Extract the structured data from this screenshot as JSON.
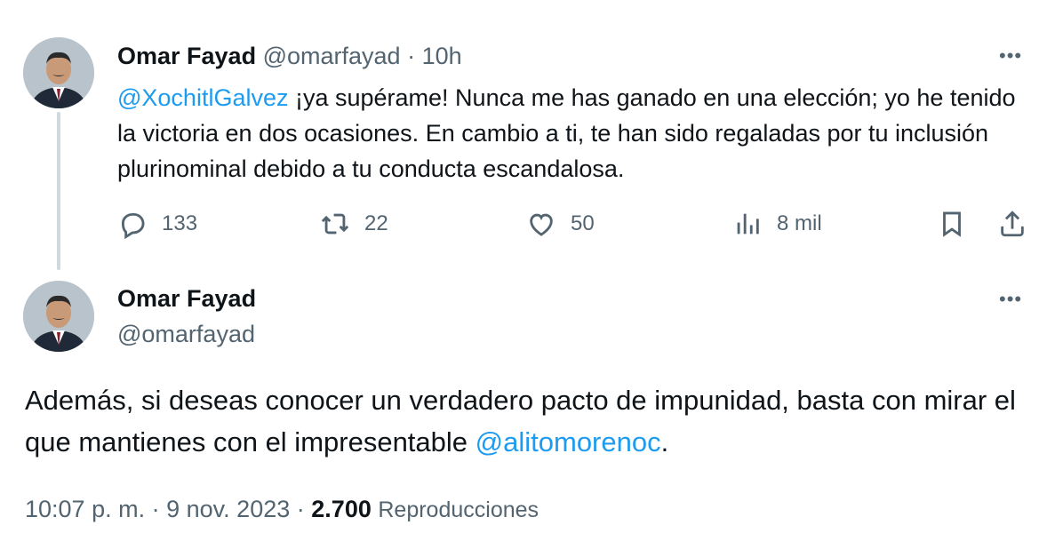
{
  "tweet1": {
    "author_name": "Omar Fayad",
    "author_handle": "@omarfayad",
    "separator": "·",
    "time_ago": "10h",
    "mention": "@XochitlGalvez",
    "text": " ¡ya supérame! Nunca me has ganado en una elección; yo he tenido la victoria en dos ocasiones. En cambio a ti, te han sido regaladas por tu inclusión plurinominal debido a tu conducta escandalosa.",
    "more_icon": "more-horizontal-icon",
    "actions": {
      "replies": "133",
      "retweets": "22",
      "likes": "50",
      "views": "8 mil"
    }
  },
  "tweet2": {
    "author_name": "Omar Fayad",
    "author_handle": "@omarfayad",
    "more_icon": "more-horizontal-icon",
    "text_before": "Además, si deseas conocer un verdadero pacto de impunidad, basta con mirar el que mantienes con el impresentable ",
    "mention": "@alitomorenoc",
    "text_after": ".",
    "time": "10:07 p. m.",
    "sep1": "·",
    "date": "9 nov. 2023",
    "sep2": "·",
    "views_count": "2.700",
    "views_label": "Reproducciones"
  },
  "colors": {
    "accent": "#1d9bf0",
    "muted": "#536471",
    "text": "#0f1419",
    "thread_line": "#cfd9de"
  }
}
